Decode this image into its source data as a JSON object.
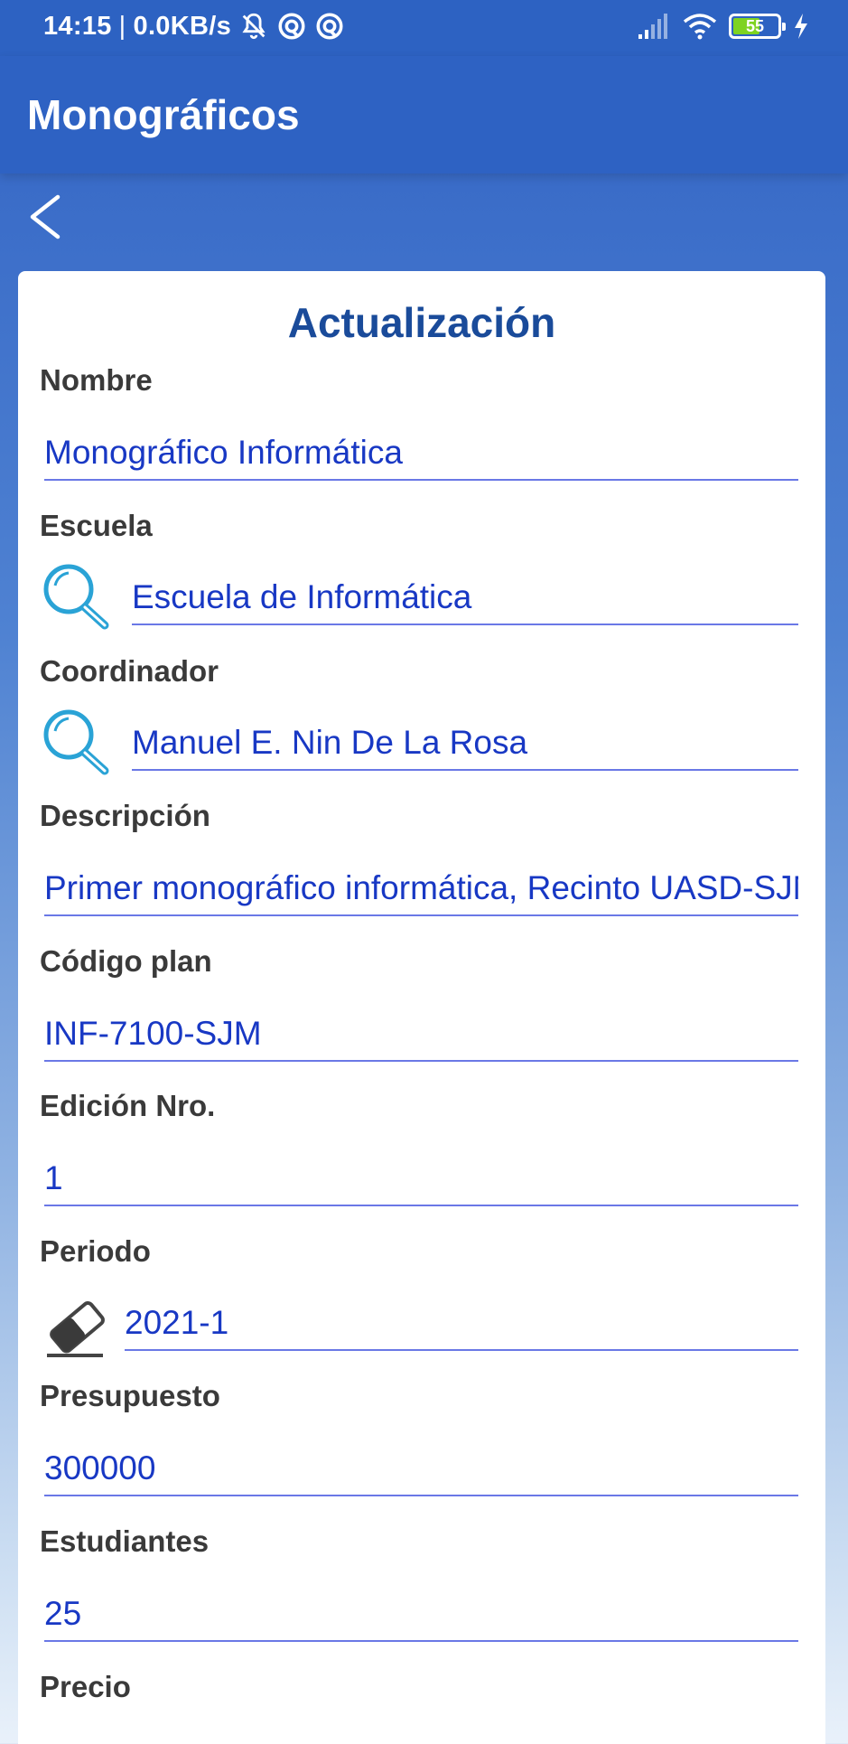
{
  "status_bar": {
    "time": "14:15",
    "speed": "0.0KB/s",
    "battery": "55"
  },
  "app_bar": {
    "title": "Monográficos"
  },
  "form": {
    "title": "Actualización",
    "fields": {
      "nombre": {
        "label": "Nombre",
        "value": "Monográfico Informática"
      },
      "escuela": {
        "label": "Escuela",
        "value": "Escuela de Informática"
      },
      "coordinador": {
        "label": "Coordinador",
        "value": "Manuel E. Nin De La Rosa"
      },
      "descripcion": {
        "label": "Descripción",
        "value": "Primer monográfico informática, Recinto UASD-SJM"
      },
      "codigo_plan": {
        "label": "Código plan",
        "value": "INF-7100-SJM"
      },
      "edicion": {
        "label": "Edición Nro.",
        "value": "1"
      },
      "periodo": {
        "label": "Periodo",
        "value": "2021-1"
      },
      "presupuesto": {
        "label": "Presupuesto",
        "value": "300000"
      },
      "estudiantes": {
        "label": "Estudiantes",
        "value": "25"
      },
      "precio": {
        "label": "Precio"
      }
    }
  },
  "colors": {
    "app_bar": "#2e62c3",
    "title": "#1a4b9a",
    "field_text": "#1838c4",
    "underline": "#6a78e6",
    "search_icon": "#2aa3d6"
  }
}
